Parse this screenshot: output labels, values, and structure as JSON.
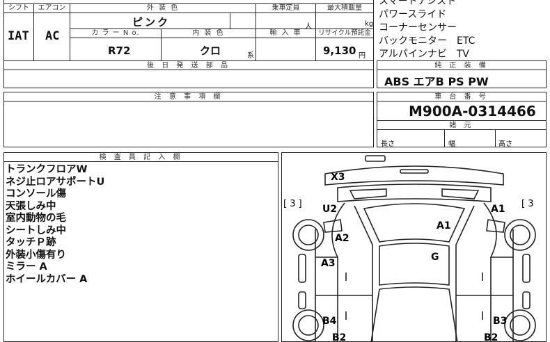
{
  "header": {
    "shift_label": "シフト",
    "aircon_label": "エアコン",
    "exterior_color_label": "外 装 色",
    "capacity_label": "乗車定員",
    "max_load_label": "最大積載量",
    "shift_value": "IAT",
    "aircon_value": "AC",
    "exterior_color_value": "ピンク",
    "capacity_unit": "人",
    "load_unit": "kg",
    "color_no_label": "カ ラ ー N o.",
    "interior_color_label": "内 装 色",
    "import_label": "輸 入 車",
    "recycle_label": "リサイクル預託金",
    "color_no_value": "R72",
    "interior_color_value": "クロ",
    "interior_suffix": "系",
    "recycle_value": "9,130",
    "recycle_unit": "円",
    "later_parts_label": "後 日 発 送 部 品"
  },
  "equipment_list": [
    "スマートアシスト",
    "パワースライド",
    "コーナーセンサー",
    "バックモニター　ETC",
    "アルパインナビ　TV"
  ],
  "standard_equipment": {
    "label": "純 正 装 備",
    "value": "ABS エアB PS PW"
  },
  "notes_section": {
    "label": "注 意 事 項 欄"
  },
  "chassis": {
    "label": "車 台 番 号",
    "value": "M900A-0314466",
    "specs_label": "諸 元",
    "length_label": "長さ",
    "width_label": "幅",
    "height_label": "高さ"
  },
  "inspector": {
    "label": "検 査 員 記 入 欄",
    "notes": [
      "トランクフロアW",
      "ネジ止ロアサポートU",
      "コンソール傷",
      "天張しみ中",
      "室内動物の毛",
      "シートしみ中",
      "タッチＰ跡",
      "外装小傷有り",
      "ミラー A",
      "ホイールカバー A"
    ]
  },
  "diagram": {
    "marks": {
      "x3": "X3",
      "u2": "U2",
      "a1": "A1",
      "a2": "A2",
      "g": "G",
      "a3": "A3",
      "b4": "B4",
      "b3": "B3",
      "b2_left": "B2",
      "b2_right": "B2",
      "left_bracket": "[ 3 ]",
      "right_bracket": "[ 3"
    }
  }
}
